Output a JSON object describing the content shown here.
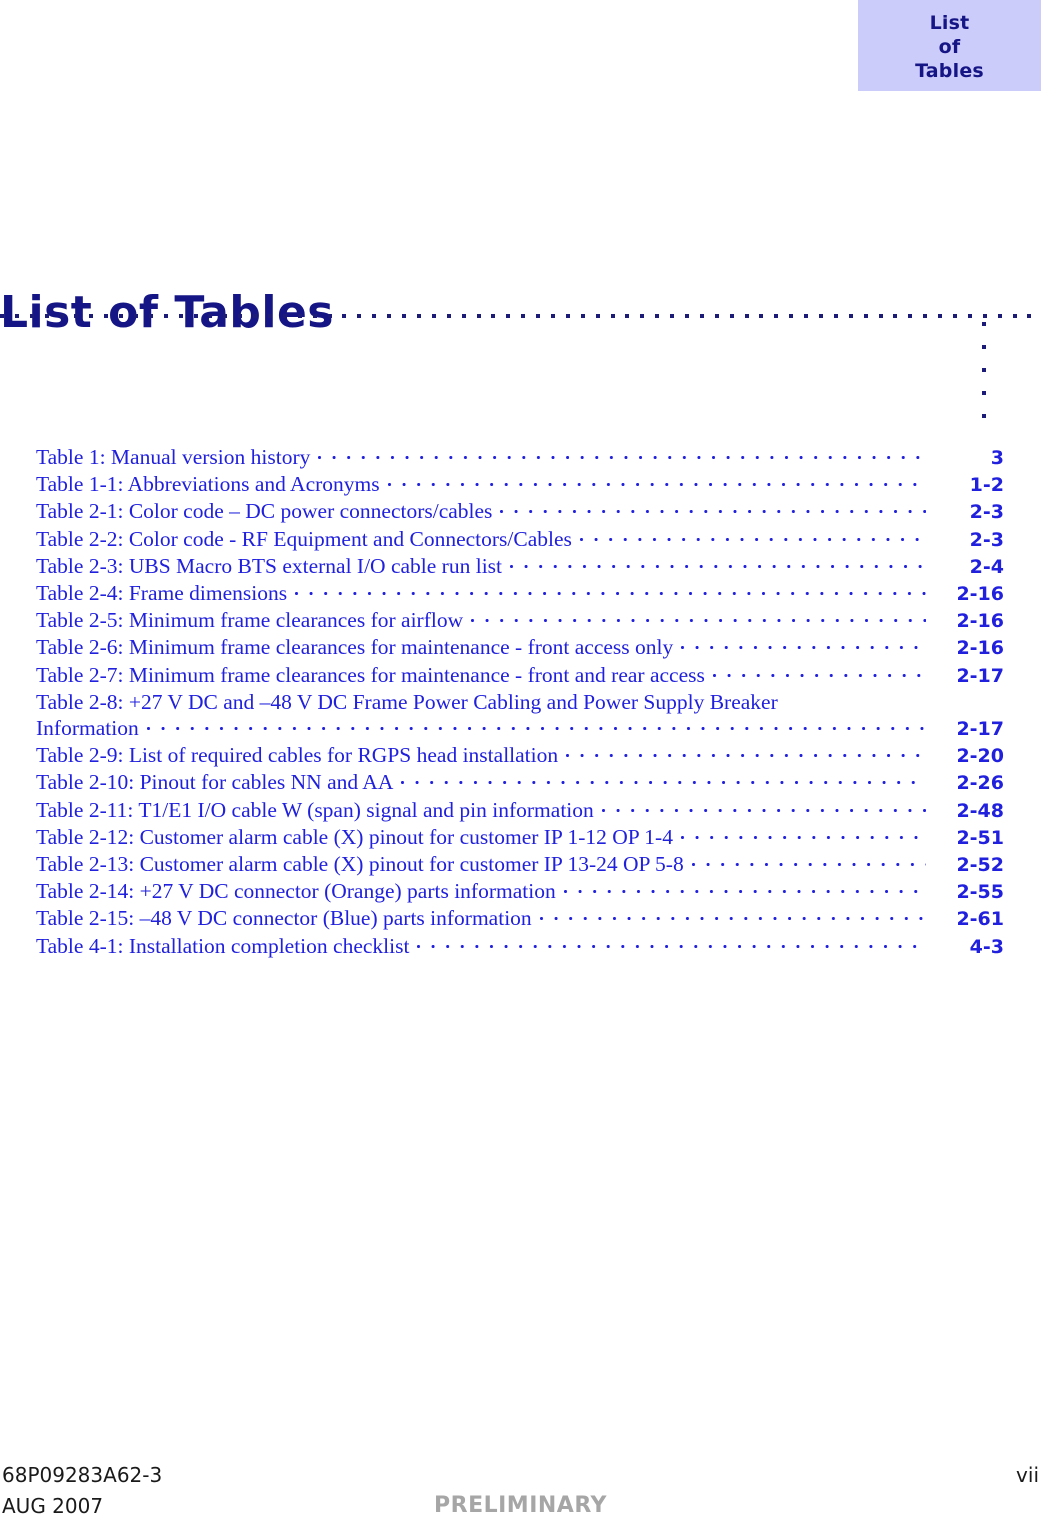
{
  "thumb_tab": {
    "lines": [
      "List",
      "of",
      "Tables"
    ],
    "background_color": "#CCCCFA",
    "text_color": "#151585"
  },
  "page_title": "List of Tables",
  "title_color": "#151585",
  "entry_color": "#2020DD",
  "rule": {
    "dot_color": "#1C1C78",
    "horizontal_dot_count": 88,
    "vertical_dot_count": 5
  },
  "toc": {
    "entries": [
      {
        "label": "Table 1: Manual version history",
        "page": "3",
        "leader": true,
        "continuation": false
      },
      {
        "label": "Table 1-1: Abbreviations and Acronyms",
        "page": "1-2",
        "leader": true,
        "continuation": false
      },
      {
        "label": "Table 2-1: Color code – DC power connectors/cables",
        "page": "2-3",
        "leader": true,
        "continuation": false
      },
      {
        "label": "Table 2-2: Color code - RF Equipment and Connectors/Cables",
        "page": "2-3",
        "leader": true,
        "continuation": false
      },
      {
        "label": "Table 2-3: UBS Macro BTS external I/O cable run list",
        "page": "2-4",
        "leader": true,
        "continuation": false
      },
      {
        "label": "Table 2-4: Frame dimensions",
        "page": "2-16",
        "leader": true,
        "continuation": false
      },
      {
        "label": "Table 2-5: Minimum frame clearances for airflow",
        "page": "2-16",
        "leader": true,
        "continuation": false
      },
      {
        "label": "Table 2-6: Minimum frame clearances for maintenance - front access only",
        "page": "2-16",
        "leader": true,
        "continuation": false
      },
      {
        "label": "Table 2-7: Minimum frame clearances for maintenance - front and rear access",
        "page": "2-17",
        "leader": true,
        "continuation": false
      },
      {
        "label": "Table 2-8:  +27 V DC and –48 V DC Frame Power Cabling and Power Supply Breaker",
        "page": "",
        "leader": false,
        "continuation": false
      },
      {
        "label": "Information",
        "page": "2-17",
        "leader": true,
        "continuation": true
      },
      {
        "label": "Table 2-9: List of required cables for RGPS head installation",
        "page": "2-20",
        "leader": true,
        "continuation": false
      },
      {
        "label": "Table 2-10: Pinout for cables NN and AA",
        "page": "2-26",
        "leader": true,
        "continuation": false
      },
      {
        "label": "Table 2-11: T1/E1 I/O cable W (span) signal and pin information",
        "page": "2-48",
        "leader": true,
        "continuation": false
      },
      {
        "label": "Table 2-12: Customer alarm cable (X) pinout for customer IP 1-12 OP 1-4",
        "page": "2-51",
        "leader": true,
        "continuation": false
      },
      {
        "label": "Table 2-13: Customer alarm cable (X) pinout for customer IP 13-24 OP 5-8",
        "page": "2-52",
        "leader": true,
        "continuation": false
      },
      {
        "label": "Table 2-14: +27 V DC connector (Orange) parts information",
        "page": "2-55",
        "leader": true,
        "continuation": false
      },
      {
        "label": "Table 2-15: –48 V DC connector (Blue) parts information",
        "page": "2-61",
        "leader": true,
        "continuation": false
      },
      {
        "label": "Table 4-1: Installation completion checklist",
        "page": "4-3",
        "leader": true,
        "continuation": false
      }
    ]
  },
  "footer": {
    "document_number": "68P09283A62-3",
    "date": "AUG 2007",
    "watermark": "PRELIMINARY",
    "page_number": "vii",
    "watermark_color": "#A6A6A6"
  }
}
